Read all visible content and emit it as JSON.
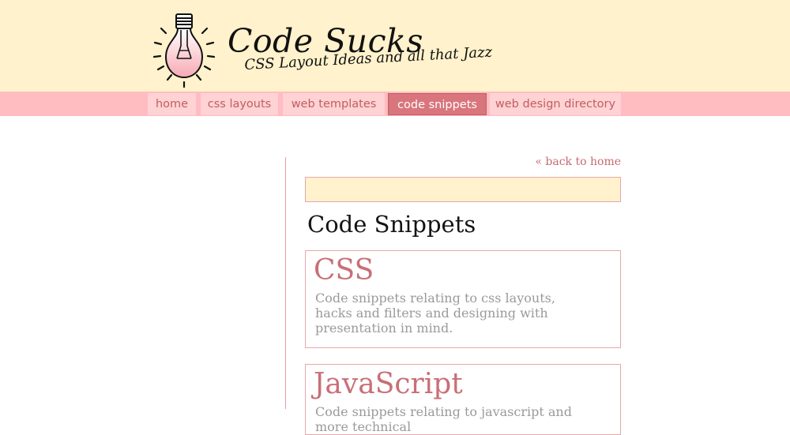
{
  "site": {
    "title": "Code Sucks",
    "tagline": "CSS Layout Ideas and all that Jazz"
  },
  "nav": {
    "items": [
      {
        "label": "home",
        "active": false
      },
      {
        "label": "css layouts",
        "active": false
      },
      {
        "label": "web templates",
        "active": false
      },
      {
        "label": "code snippets",
        "active": true
      },
      {
        "label": "web design directory",
        "active": false
      }
    ]
  },
  "content": {
    "back_link": "« back to home",
    "page_title": "Code Snippets",
    "search_value": "",
    "cards": [
      {
        "title": "CSS",
        "description": "Code snippets relating to css layouts, hacks and filters and designing with presentation in mind."
      },
      {
        "title": "JavaScript",
        "description": "Code snippets relating to javascript and more technical"
      }
    ]
  },
  "colors": {
    "header_bg": "#fff2cc",
    "nav_bar": "#ffbcc1",
    "nav_item": "#ffd2d4",
    "nav_active": "#d9757c",
    "accent_text": "#c96f77"
  },
  "icons": [
    "light-bulb-logo-icon"
  ]
}
